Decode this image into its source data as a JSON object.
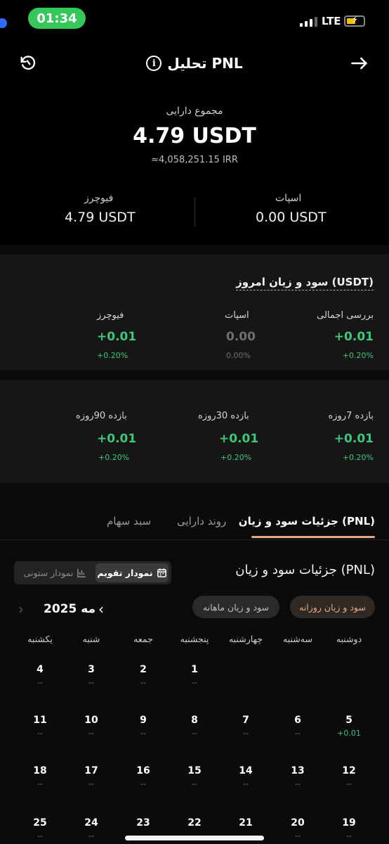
{
  "status": {
    "time": "01:34",
    "network": "LTE"
  },
  "header": {
    "title": "تحلیل PNL",
    "info_glyph": "i"
  },
  "assets": {
    "label": "مجموع دارایی",
    "value": "4.79 USDT",
    "irr": "≈4,058,251.15 IRR",
    "futures_label": "فیوچرز",
    "futures_value": "4.79 USDT",
    "spot_label": "اسپات",
    "spot_value": "0.00 USDT"
  },
  "pnl_today": {
    "title": "سود و زیان امروز (USDT)",
    "columns": [
      {
        "label": "بررسی اجمالی",
        "value": "+0.01",
        "pct": "+0.20%",
        "state": "green"
      },
      {
        "label": "اسپات",
        "value": "0.00",
        "pct": "0.00%",
        "state": "grey"
      },
      {
        "label": "فیوچرز",
        "value": "+0.01",
        "pct": "+0.20%",
        "state": "green"
      }
    ]
  },
  "periods": [
    {
      "label": "بازده 7روزه",
      "value": "+0.01",
      "pct": "+0.20%"
    },
    {
      "label": "بازده 30روزه",
      "value": "+0.01",
      "pct": "+0.20%"
    },
    {
      "label": "بازده 90روزه",
      "value": "+0.01",
      "pct": "+0.20%"
    }
  ],
  "tabs": [
    {
      "label": "جزئیات سود و زیان (PNL)",
      "active": true
    },
    {
      "label": "روند دارایی",
      "active": false
    },
    {
      "label": "سبد سهام",
      "active": false
    }
  ],
  "details": {
    "title": "جزئیات سود و زیان (PNL)",
    "toggle_calendar": "نمودار تقویم",
    "toggle_bar": "نمودار ستونی",
    "chip_daily": "سود و زیان روزانه",
    "chip_monthly": "سود و زیان ماهانه",
    "month": "مه",
    "year": "2025"
  },
  "weekdays": [
    "دوشنبه",
    "سه‌شنبه",
    "چهارشنبه",
    "پنجشنبه",
    "جمعه",
    "شنبه",
    "یکشنبه"
  ],
  "calendar_weeks": [
    [
      null,
      null,
      null,
      {
        "d": "1",
        "p": "--"
      },
      {
        "d": "2",
        "p": "--"
      },
      {
        "d": "3",
        "p": "--"
      },
      {
        "d": "4",
        "p": "--"
      }
    ],
    [
      {
        "d": "5",
        "p": "+0.01"
      },
      {
        "d": "6",
        "p": "--"
      },
      {
        "d": "7",
        "p": "--"
      },
      {
        "d": "8",
        "p": "--"
      },
      {
        "d": "9",
        "p": "--"
      },
      {
        "d": "10",
        "p": "--"
      },
      {
        "d": "11",
        "p": "--"
      }
    ],
    [
      {
        "d": "12",
        "p": "--"
      },
      {
        "d": "13",
        "p": "--"
      },
      {
        "d": "14",
        "p": "--"
      },
      {
        "d": "15",
        "p": "--"
      },
      {
        "d": "16",
        "p": "--"
      },
      {
        "d": "17",
        "p": "--"
      },
      {
        "d": "18",
        "p": "--"
      }
    ],
    [
      {
        "d": "19",
        "p": "--"
      },
      {
        "d": "20",
        "p": "--"
      },
      {
        "d": "21",
        "p": "--"
      },
      {
        "d": "22",
        "p": "--"
      },
      {
        "d": "23",
        "p": "--"
      },
      {
        "d": "24",
        "p": "--"
      },
      {
        "d": "25",
        "p": "--"
      }
    ]
  ],
  "colors": {
    "accent": "#e0a985",
    "positive": "#3ec77a",
    "pill": "#35c759"
  }
}
